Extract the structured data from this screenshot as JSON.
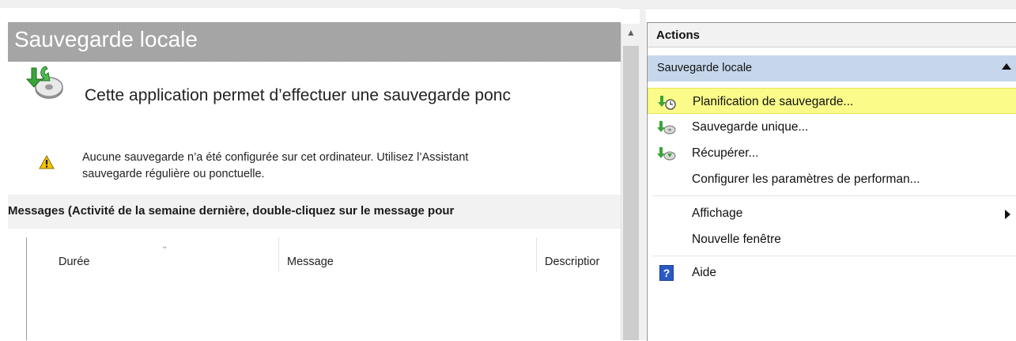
{
  "page": {
    "title": "Sauvegarde locale",
    "intro": "Cette application permet d’effectuer une sauvegarde ponc",
    "warning": {
      "line1": "Aucune sauvegarde n’a été configurée sur cet ordinateur. Utilisez l’Assistant",
      "line2": "sauvegarde régulière ou ponctuelle."
    },
    "messages_header": "Messages (Activité de la semaine dernière, double-cliquez sur le message pour",
    "columns": [
      "Durée",
      "Message",
      "Descriptior"
    ]
  },
  "actions": {
    "header": "Actions",
    "section": "Sauvegarde locale",
    "items": [
      {
        "label": "Planification de sauvegarde...",
        "icon": "backup-schedule-icon",
        "highlighted": true
      },
      {
        "label": "Sauvegarde unique...",
        "icon": "backup-once-icon"
      },
      {
        "label": "Récupérer...",
        "icon": "recover-icon"
      },
      {
        "label": "Configurer les paramètres de performan...",
        "icon": ""
      },
      {
        "label": "Affichage",
        "icon": "",
        "submenu": true
      },
      {
        "label": "Nouvelle fenêtre",
        "icon": ""
      },
      {
        "label": "Aide",
        "icon": "help-icon"
      }
    ]
  },
  "colors": {
    "highlight": "#fbfb8a",
    "section_bg": "#c6d7ec",
    "banner_bg": "#a3a3a3",
    "help_blue": "#2b59c3"
  }
}
